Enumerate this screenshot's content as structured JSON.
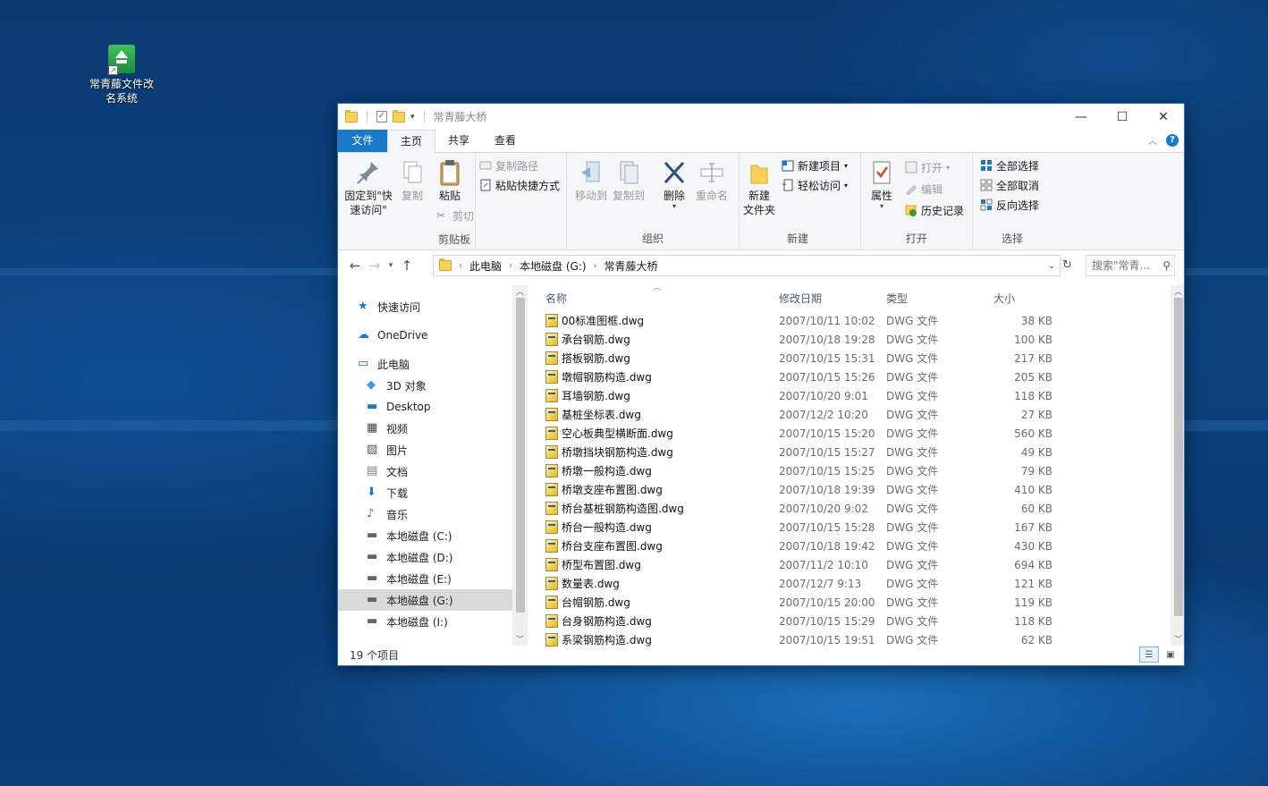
{
  "desktop": {
    "icon_label": "常青藤文件改名系统"
  },
  "window": {
    "title": "常青藤大桥",
    "ribbon_tabs": [
      "文件",
      "主页",
      "共享",
      "查看"
    ],
    "ribbon": {
      "clipboard": {
        "label": "剪贴板",
        "pin": "固定到\"快速访问\"",
        "copy": "复制",
        "paste": "粘贴",
        "copy_path": "复制路径",
        "paste_shortcut": "粘贴快捷方式",
        "cut": "剪切"
      },
      "organize": {
        "label": "组织",
        "move_to": "移动到",
        "copy_to": "复制到",
        "delete": "删除",
        "rename": "重命名"
      },
      "new": {
        "label": "新建",
        "new_folder": "新建\n文件夹",
        "new_item": "新建项目",
        "easy_access": "轻松访问"
      },
      "open": {
        "label": "打开",
        "properties": "属性",
        "open": "打开",
        "edit": "编辑",
        "history": "历史记录"
      },
      "select": {
        "label": "选择",
        "select_all": "全部选择",
        "select_none": "全部取消",
        "invert": "反向选择"
      }
    },
    "address": {
      "crumbs": [
        "此电脑",
        "本地磁盘 (G:)",
        "常青藤大桥"
      ],
      "search_placeholder": "搜索\"常青..."
    },
    "nav_pane": [
      {
        "label": "快速访问",
        "icon": "star-icon",
        "indent": 0
      },
      {
        "label": "OneDrive",
        "icon": "cloud-icon",
        "indent": 0
      },
      {
        "label": "此电脑",
        "icon": "computer-icon",
        "indent": 0
      },
      {
        "label": "3D 对象",
        "icon": "cube-icon",
        "indent": 1
      },
      {
        "label": "Desktop",
        "icon": "desktop-icon",
        "indent": 1
      },
      {
        "label": "视频",
        "icon": "video-icon",
        "indent": 1
      },
      {
        "label": "图片",
        "icon": "picture-icon",
        "indent": 1
      },
      {
        "label": "文档",
        "icon": "document-icon",
        "indent": 1
      },
      {
        "label": "下载",
        "icon": "download-icon",
        "indent": 1
      },
      {
        "label": "音乐",
        "icon": "music-icon",
        "indent": 1
      },
      {
        "label": "本地磁盘 (C:)",
        "icon": "drive-icon",
        "indent": 1
      },
      {
        "label": "本地磁盘 (D:)",
        "icon": "drive-icon",
        "indent": 1
      },
      {
        "label": "本地磁盘 (E:)",
        "icon": "drive-icon",
        "indent": 1
      },
      {
        "label": "本地磁盘 (G:)",
        "icon": "drive-icon",
        "indent": 1,
        "selected": true
      },
      {
        "label": "本地磁盘 (I:)",
        "icon": "drive-icon",
        "indent": 1
      }
    ],
    "columns": {
      "name": "名称",
      "date": "修改日期",
      "type": "类型",
      "size": "大小"
    },
    "files": [
      {
        "name": "00标准图框.dwg",
        "date": "2007/10/11 10:02",
        "type": "DWG 文件",
        "size": "38 KB"
      },
      {
        "name": "承台钢筋.dwg",
        "date": "2007/10/18 19:28",
        "type": "DWG 文件",
        "size": "100 KB"
      },
      {
        "name": "搭板钢筋.dwg",
        "date": "2007/10/15 15:31",
        "type": "DWG 文件",
        "size": "217 KB"
      },
      {
        "name": "墩帽钢筋构造.dwg",
        "date": "2007/10/15 15:26",
        "type": "DWG 文件",
        "size": "205 KB"
      },
      {
        "name": "耳墙钢筋.dwg",
        "date": "2007/10/20 9:01",
        "type": "DWG 文件",
        "size": "118 KB"
      },
      {
        "name": "基桩坐标表.dwg",
        "date": "2007/12/2 10:20",
        "type": "DWG 文件",
        "size": "27 KB"
      },
      {
        "name": "空心板典型横断面.dwg",
        "date": "2007/10/15 15:20",
        "type": "DWG 文件",
        "size": "560 KB"
      },
      {
        "name": "桥墩挡块钢筋构造.dwg",
        "date": "2007/10/15 15:27",
        "type": "DWG 文件",
        "size": "49 KB"
      },
      {
        "name": "桥墩一般构造.dwg",
        "date": "2007/10/15 15:25",
        "type": "DWG 文件",
        "size": "79 KB"
      },
      {
        "name": "桥墩支座布置图.dwg",
        "date": "2007/10/18 19:39",
        "type": "DWG 文件",
        "size": "410 KB"
      },
      {
        "name": "桥台基桩钢筋构造图.dwg",
        "date": "2007/10/20 9:02",
        "type": "DWG 文件",
        "size": "60 KB"
      },
      {
        "name": "桥台一般构造.dwg",
        "date": "2007/10/15 15:28",
        "type": "DWG 文件",
        "size": "167 KB"
      },
      {
        "name": "桥台支座布置图.dwg",
        "date": "2007/10/18 19:42",
        "type": "DWG 文件",
        "size": "430 KB"
      },
      {
        "name": "桥型布置图.dwg",
        "date": "2007/11/2 10:10",
        "type": "DWG 文件",
        "size": "694 KB"
      },
      {
        "name": "数量表.dwg",
        "date": "2007/12/7 9:13",
        "type": "DWG 文件",
        "size": "121 KB"
      },
      {
        "name": "台帽钢筋.dwg",
        "date": "2007/10/15 20:00",
        "type": "DWG 文件",
        "size": "119 KB"
      },
      {
        "name": "台身钢筋构造.dwg",
        "date": "2007/10/15 15:29",
        "type": "DWG 文件",
        "size": "118 KB"
      },
      {
        "name": "系梁钢筋构造.dwg",
        "date": "2007/10/15 19:51",
        "type": "DWG 文件",
        "size": "62 KB"
      }
    ],
    "status": "19 个项目",
    "colors": {
      "accent": "#1979ca",
      "selected_nav": "#d9d9d9"
    }
  }
}
